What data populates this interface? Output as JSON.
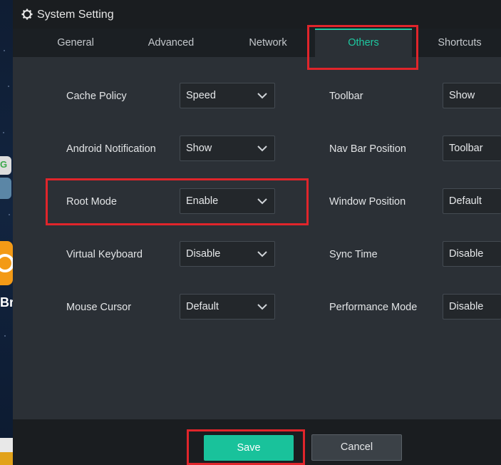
{
  "window": {
    "title": "System Setting"
  },
  "tabs": [
    {
      "label": "General"
    },
    {
      "label": "Advanced"
    },
    {
      "label": "Network"
    },
    {
      "label": "Others",
      "active": true
    },
    {
      "label": "Shortcuts"
    }
  ],
  "settings": {
    "left": [
      {
        "label": "Cache Policy",
        "value": "Speed"
      },
      {
        "label": "Android Notification",
        "value": "Show"
      },
      {
        "label": "Root Mode",
        "value": "Enable"
      },
      {
        "label": "Virtual Keyboard",
        "value": "Disable"
      },
      {
        "label": "Mouse Cursor",
        "value": "Default"
      }
    ],
    "right": [
      {
        "label": "Toolbar",
        "value": "Show"
      },
      {
        "label": "Nav Bar Position",
        "value": "Toolbar"
      },
      {
        "label": "Window Position",
        "value": "Default"
      },
      {
        "label": "Sync Time",
        "value": "Disable"
      },
      {
        "label": "Performance Mode",
        "value": "Disable"
      }
    ]
  },
  "footer": {
    "save_label": "Save",
    "cancel_label": "Cancel"
  },
  "background": {
    "partial_text": "Br"
  },
  "colors": {
    "accent": "#1ec8a0",
    "highlight": "#e0252b",
    "save_button": "#19c29b"
  },
  "icons": {
    "title": "gear-icon",
    "dropdown": "chevron-down-icon"
  }
}
